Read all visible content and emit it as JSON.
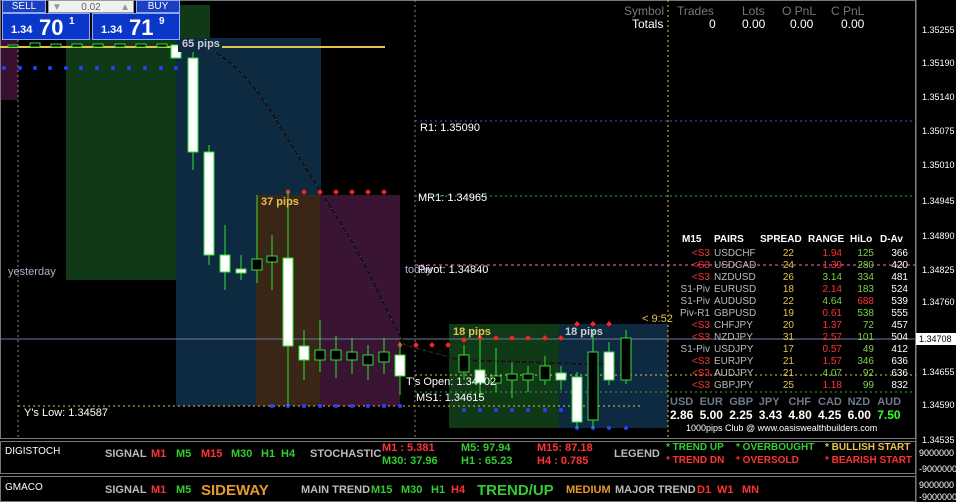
{
  "trade_panel": {
    "sell_label": "SELL",
    "buy_label": "BUY",
    "lot_value": "0.02",
    "sell_small": "1.34",
    "sell_big": "70",
    "sell_sup": "1",
    "buy_small": "1.34",
    "buy_big": "71",
    "buy_sup": "9"
  },
  "totals": {
    "headers": [
      "Symbol",
      "Trades",
      "Lots",
      "O PnL",
      "C PnL"
    ],
    "row_label": "Totals",
    "values": [
      "0",
      "0.00",
      "0.00",
      "0.00"
    ]
  },
  "chart": {
    "price_axis": [
      "1.35255",
      "1.35190",
      "1.35140",
      "1.35075",
      "1.35010",
      "1.34945",
      "1.34890",
      "1.34825",
      "1.34760",
      "1.34708",
      "1.34655",
      "1.34590",
      "1.34535"
    ],
    "current_price": "1.34708",
    "levels": {
      "r1": "R1: 1.35090",
      "mr1": "MR1: 1.34965",
      "pivot": "Pivot: 1.34840",
      "ts_open": "T's Open: 1.34702",
      "ms1": "MS1: 1.34615",
      "ys_low": "Y's Low: 1.34587",
      "yesterday": "yesterday",
      "today": "today"
    },
    "pip_labels": [
      "65 pips",
      "37 pips",
      "18 pips",
      "18 pips"
    ],
    "countdown": "< 9:52"
  },
  "pairs_table": {
    "headers": [
      "M15",
      "PAIRS",
      "SPREAD",
      "RANGE",
      "HiLo",
      "D-Av"
    ],
    "rows": [
      {
        "sig": "<S3",
        "pair": "USDCHF",
        "spread": "22",
        "range": "1.94",
        "hilo": "125",
        "dav": "366",
        "sig_color": "#ff3333",
        "range_color": "#ff3333",
        "hilo_color": "#7fd24a"
      },
      {
        "sig": "<S3",
        "pair": "USDCAD",
        "spread": "24",
        "range": "1.39",
        "hilo": "280",
        "dav": "420",
        "sig_color": "#ff3333",
        "range_color": "#ff3333",
        "hilo_color": "#7fd24a"
      },
      {
        "sig": "<S3",
        "pair": "NZDUSD",
        "spread": "26",
        "range": "3.14",
        "hilo": "334",
        "dav": "481",
        "sig_color": "#ff3333",
        "range_color": "#7fd24a",
        "hilo_color": "#7fd24a"
      },
      {
        "sig": "S1-Piv",
        "pair": "EURUSD",
        "spread": "18",
        "range": "2.14",
        "hilo": "183",
        "dav": "524",
        "sig_color": "#bbbbbb",
        "range_color": "#ff3333",
        "hilo_color": "#7fd24a"
      },
      {
        "sig": "S1-Piv",
        "pair": "AUDUSD",
        "spread": "22",
        "range": "4.64",
        "hilo": "688",
        "dav": "539",
        "sig_color": "#bbbbbb",
        "range_color": "#7fd24a",
        "hilo_color": "#ff3333"
      },
      {
        "sig": "Piv-R1",
        "pair": "GBPUSD",
        "spread": "19",
        "range": "0.61",
        "hilo": "538",
        "dav": "555",
        "sig_color": "#bbbbbb",
        "range_color": "#ff3333",
        "hilo_color": "#7fd24a"
      },
      {
        "sig": "<S3",
        "pair": "CHFJPY",
        "spread": "20",
        "range": "1.37",
        "hilo": "72",
        "dav": "457",
        "sig_color": "#ff3333",
        "range_color": "#ff3333",
        "hilo_color": "#7fd24a"
      },
      {
        "sig": "<S3",
        "pair": "NZDJPY",
        "spread": "31",
        "range": "2.57",
        "hilo": "101",
        "dav": "504",
        "sig_color": "#ff3333",
        "range_color": "#ff3333",
        "hilo_color": "#7fd24a"
      },
      {
        "sig": "S1-Piv",
        "pair": "USDJPY",
        "spread": "17",
        "range": "0.57",
        "hilo": "49",
        "dav": "412",
        "sig_color": "#bbbbbb",
        "range_color": "#ff3333",
        "hilo_color": "#7fd24a"
      },
      {
        "sig": "<S3",
        "pair": "EURJPY",
        "spread": "21",
        "range": "1.57",
        "hilo": "346",
        "dav": "636",
        "sig_color": "#ff3333",
        "range_color": "#ff3333",
        "hilo_color": "#7fd24a"
      },
      {
        "sig": "<S3",
        "pair": "AUDJPY",
        "spread": "21",
        "range": "4.07",
        "hilo": "92",
        "dav": "636",
        "sig_color": "#ff3333",
        "range_color": "#7fd24a",
        "hilo_color": "#7fd24a"
      },
      {
        "sig": "<S3",
        "pair": "GBPJPY",
        "spread": "25",
        "range": "1.18",
        "hilo": "99",
        "dav": "832",
        "sig_color": "#ff3333",
        "range_color": "#ff3333",
        "hilo_color": "#7fd24a"
      }
    ],
    "currencies": [
      "USD",
      "EUR",
      "GBP",
      "JPY",
      "CHF",
      "CAD",
      "NZD",
      "AUD"
    ],
    "strengths": [
      "2.86",
      "5.00",
      "2.25",
      "3.43",
      "4.80",
      "4.25",
      "6.00",
      "7.50"
    ],
    "strength_colors": [
      "#ffffff",
      "#ffffff",
      "#ffffff",
      "#ffffff",
      "#ffffff",
      "#ffffff",
      "#ffffff",
      "#33ff33"
    ],
    "footer": "1000pips Club @ www.oasiswealthbuilders.com"
  },
  "digistoch": {
    "name": "DIGISTOCH",
    "signal": "SIGNAL",
    "tfs": [
      "M1",
      "M5",
      "M15",
      "M30",
      "H1",
      "H4"
    ],
    "tf_colors": [
      "#ff3333",
      "#33cc33",
      "#ff3333",
      "#33cc33",
      "#33cc33",
      "#33cc33"
    ],
    "stochastic": "STOCHASTIC",
    "m1": "M1 : 5.381",
    "m5": "M5: 97.94",
    "m15": "M15: 87.18",
    "m30": "M30: 37.96",
    "h1": "H1 : 65.23",
    "h4": "H4 : 0.785",
    "legend": "LEGEND",
    "trend_up": "* TREND UP",
    "trend_dn": "* TREND DN",
    "overbought": "* OVERBOUGHT",
    "oversold": "* OVERSOLD",
    "bull": "* BULLISH START",
    "bear": "* BEARISH START",
    "axis_top": "9000000",
    "axis_bottom": "-9000000"
  },
  "gmaco": {
    "name": "GMACO",
    "signal": "SIGNAL",
    "tfs_a": [
      "M1",
      "M5"
    ],
    "tfs_a_colors": [
      "#ff3333",
      "#33cc33"
    ],
    "sideway": "SIDEWAY",
    "main_trend": "MAIN TREND",
    "tfs_b": [
      "M15",
      "M30",
      "H1",
      "H4"
    ],
    "tfs_b_colors": [
      "#33cc33",
      "#33cc33",
      "#33cc33",
      "#ff3333"
    ],
    "trendup": "TREND/UP",
    "medium": "MEDIUM",
    "major_trend": "MAJOR TREND",
    "tfs_c": [
      "D1",
      "W1",
      "MN"
    ],
    "axis_top": "9000000",
    "axis_bottom": "-9000000"
  }
}
